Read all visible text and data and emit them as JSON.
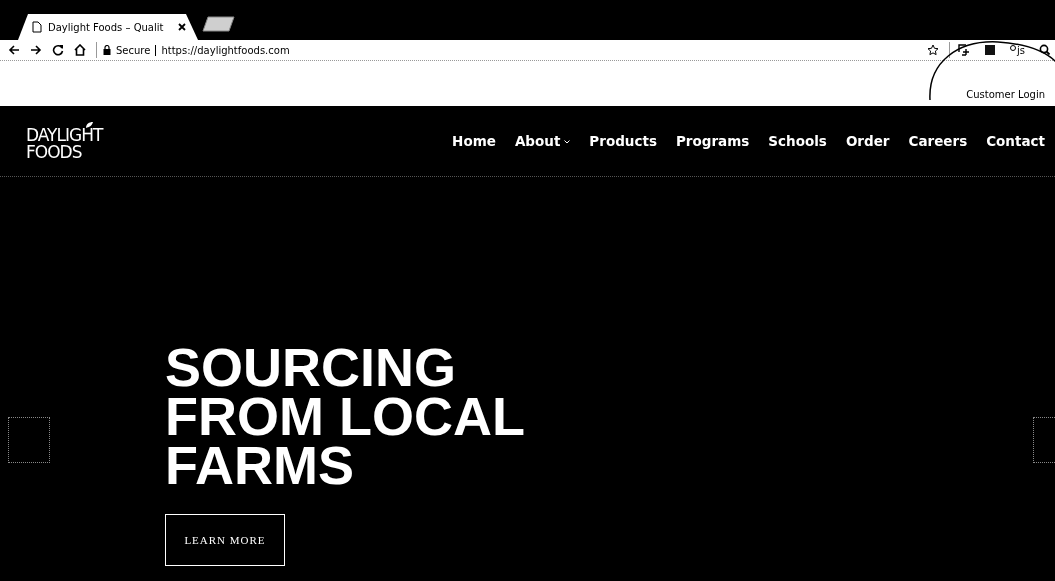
{
  "browser": {
    "tabs": [
      {
        "title": "Daylight Foods – Qualit",
        "selected": true
      }
    ],
    "address_bar": {
      "security": "Secure",
      "url": "https://daylightfoods.com"
    },
    "extensions": [
      {
        "kind": "crop"
      },
      {
        "kind": "dark"
      },
      {
        "kind": "js",
        "label": "js"
      },
      {
        "kind": "search"
      }
    ]
  },
  "utility_bar": {
    "link": "Customer Login"
  },
  "site_nav": {
    "logo": [
      "DAYLIGHT",
      "FOODS"
    ],
    "items": [
      {
        "label": "Home",
        "dropdown": false
      },
      {
        "label": "About",
        "dropdown": true
      },
      {
        "label": "Products",
        "dropdown": false
      },
      {
        "label": "Programs",
        "dropdown": false
      },
      {
        "label": "Schools",
        "dropdown": false
      },
      {
        "label": "Order",
        "dropdown": false
      },
      {
        "label": "Careers",
        "dropdown": false
      },
      {
        "label": "Contact",
        "dropdown": false
      }
    ]
  },
  "hero": {
    "headline": "SOURCING FROM LOCAL FARMS",
    "button": "LEARN MORE"
  }
}
